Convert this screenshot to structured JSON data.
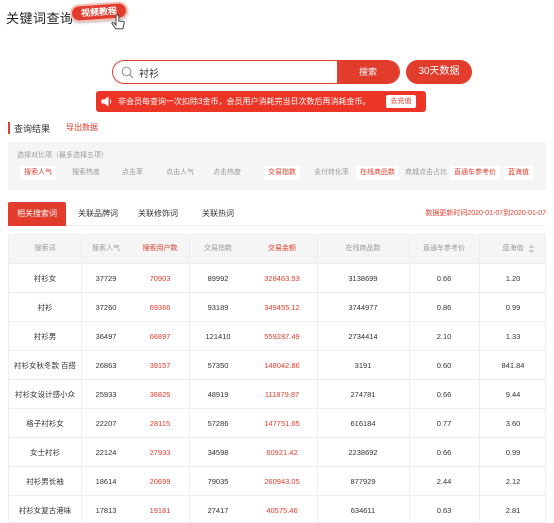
{
  "header": {
    "title": "关键词查询",
    "badge": "视频教程"
  },
  "search": {
    "value": "衬衫",
    "button": "搜索",
    "days_button": "30天数据"
  },
  "notice": {
    "text": "非会员每查询一次扣除3金币，会员用户消耗完当日次数后再消耗金币。",
    "button": "去充值"
  },
  "result": {
    "title": "查询结果",
    "export": "导出数据"
  },
  "compare": {
    "hint": "选择对比项（最多选择五项）",
    "chips": [
      {
        "label": "搜索人气",
        "selected": true
      },
      {
        "label": "搜索热度",
        "selected": false
      },
      {
        "label": "点击率",
        "selected": false
      },
      {
        "label": "点击人气",
        "selected": false
      },
      {
        "label": "点击热度",
        "selected": false
      },
      {
        "label": "交易指数",
        "selected": true
      },
      {
        "label": "支付转化率",
        "selected": false
      },
      {
        "label": "在线商品数",
        "selected": true
      },
      {
        "label": "商城点击占比",
        "selected": false
      },
      {
        "label": "直通车参考价",
        "selected": true
      },
      {
        "label": "蓝海值",
        "selected": true
      }
    ]
  },
  "tabs": [
    "相关搜索词",
    "关联品牌词",
    "关联修饰词",
    "关联热词"
  ],
  "update_time": "数据更新时间2020-01-07到2020-01-07",
  "table": {
    "headers": [
      "搜索词",
      "搜索人气",
      "搜索用户数",
      "交易指数",
      "交易金额",
      "在线商品数",
      "直通车参考价",
      "蓝海值"
    ],
    "rows": [
      [
        "衬衫女",
        "37729",
        "70903",
        "89992",
        "328463.53",
        "3138699",
        "0.66",
        "1.20"
      ],
      [
        "衬衫",
        "37260",
        "69366",
        "93189",
        "349455.12",
        "3744977",
        "0.86",
        "0.99"
      ],
      [
        "衬衫男",
        "36497",
        "66897",
        "121410",
        "559287.49",
        "2734414",
        "2.10",
        "1.33"
      ],
      [
        "衬衫女秋冬款 百搭",
        "26863",
        "39157",
        "57350",
        "148042.86",
        "3191",
        "0.60",
        "841.84"
      ],
      [
        "衬衫女设计感小众",
        "25933",
        "36825",
        "48919",
        "111879.87",
        "274781",
        "0.66",
        "9.44"
      ],
      [
        "格子衬衫女",
        "22207",
        "28115",
        "57286",
        "147751.65",
        "616184",
        "0.77",
        "3.60"
      ],
      [
        "女士衬衫",
        "22124",
        "27933",
        "34598",
        "60921.42",
        "2238692",
        "0.66",
        "0.99"
      ],
      [
        "衬衫男长袖",
        "18614",
        "20699",
        "79035",
        "260943.05",
        "877929",
        "2.44",
        "2.12"
      ],
      [
        "衬衫女复古港味",
        "17813",
        "19181",
        "27417",
        "40575.46",
        "634611",
        "0.63",
        "2.81"
      ]
    ]
  }
}
